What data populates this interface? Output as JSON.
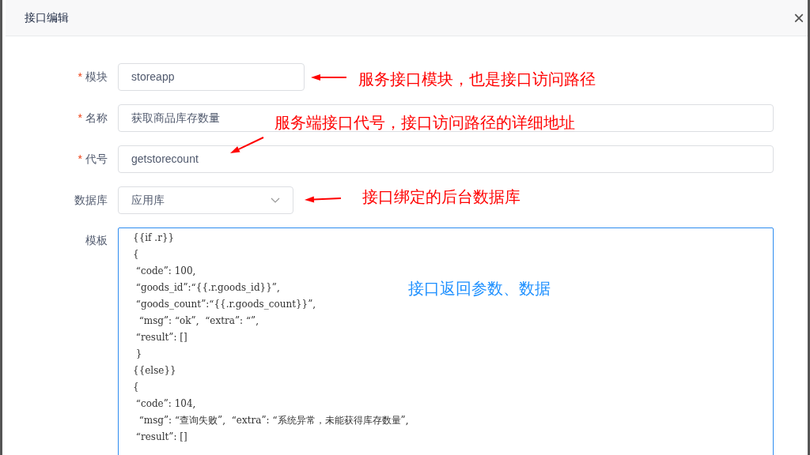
{
  "dialog": {
    "title": "接口编辑",
    "close": "×"
  },
  "fields": [
    {
      "marker": "*",
      "label": "模块",
      "kind": "input",
      "value": "storeapp"
    },
    {
      "marker": "*",
      "label": "名称",
      "kind": "input",
      "value": "获取商品库存数量"
    },
    {
      "marker": "*",
      "label": "代号",
      "kind": "input",
      "value": "getstorecount"
    },
    {
      "label": "数据库",
      "kind": "select",
      "value": "应用库"
    }
  ],
  "template": {
    "label": "模板",
    "lines": [
      "{{if .r}}",
      "{",
      " “code”: 100,",
      " “goods_id”:“{{.r.goods_id}}”,",
      " “goods_count”:“{{.r.goods_count}}”,",
      "  “msg”: “ok”,  “extra”: “”,",
      " “result”: []",
      " }",
      "{{else}}",
      "{",
      " “code”: 104,",
      "  “msg”: “查询失败”,  “extra”: “系统异常，未能获得库存数量”,",
      " “result”: []"
    ]
  },
  "annotations": [
    {
      "text": "服务接口模块，也是接口访问路径",
      "color": "#ff0000",
      "arrow": true
    },
    {
      "text": "服务端接口代号，接口访问路径的详细地址",
      "color": "#ff0000",
      "arrow": true
    },
    {
      "text": "接口绑定的后台数据库",
      "color": "#ff0000",
      "arrow": true
    },
    {
      "text": "接口返回参数、数据",
      "color": "#1e90ff",
      "arrow": false
    }
  ]
}
